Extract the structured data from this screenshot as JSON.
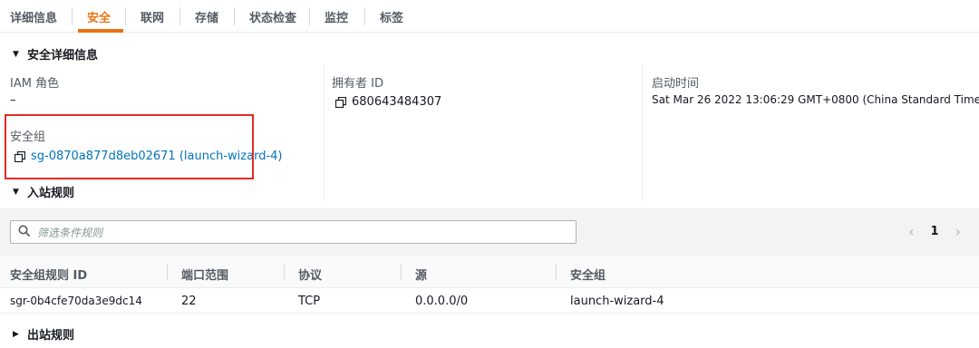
{
  "tabs": [
    {
      "label": "详细信息",
      "active": false
    },
    {
      "label": "安全",
      "active": true
    },
    {
      "label": "联网",
      "active": false
    },
    {
      "label": "存储",
      "active": false
    },
    {
      "label": "状态检查",
      "active": false
    },
    {
      "label": "监控",
      "active": false
    },
    {
      "label": "标签",
      "active": false
    }
  ],
  "security_details": {
    "header": "安全详细信息",
    "iam_role_label": "IAM 角色",
    "iam_role_value": "–",
    "owner_id_label": "拥有者 ID",
    "owner_id_value": "680643484307",
    "launch_time_label": "启动时间",
    "launch_time_value": "Sat Mar 26 2022 13:06:29 GMT+0800 (China Standard Time)",
    "security_group_label": "安全组",
    "security_group_value": "sg-0870a877d8eb02671 (launch-wizard-4)"
  },
  "inbound_rules": {
    "header": "入站规则",
    "search_placeholder": "筛选条件规则",
    "current_page": "1",
    "columns": [
      "安全组规则 ID",
      "端口范围",
      "协议",
      "源",
      "安全组"
    ],
    "rows": [
      [
        "sgr-0b4cfe70da3e9dc14",
        "22",
        "TCP",
        "0.0.0.0/0",
        "launch-wizard-4"
      ]
    ]
  },
  "outbound_rules": {
    "header": "出站规则"
  },
  "colors": {
    "accent": "#ec7211",
    "link": "#0073bb",
    "highlight": "#e02b23"
  }
}
